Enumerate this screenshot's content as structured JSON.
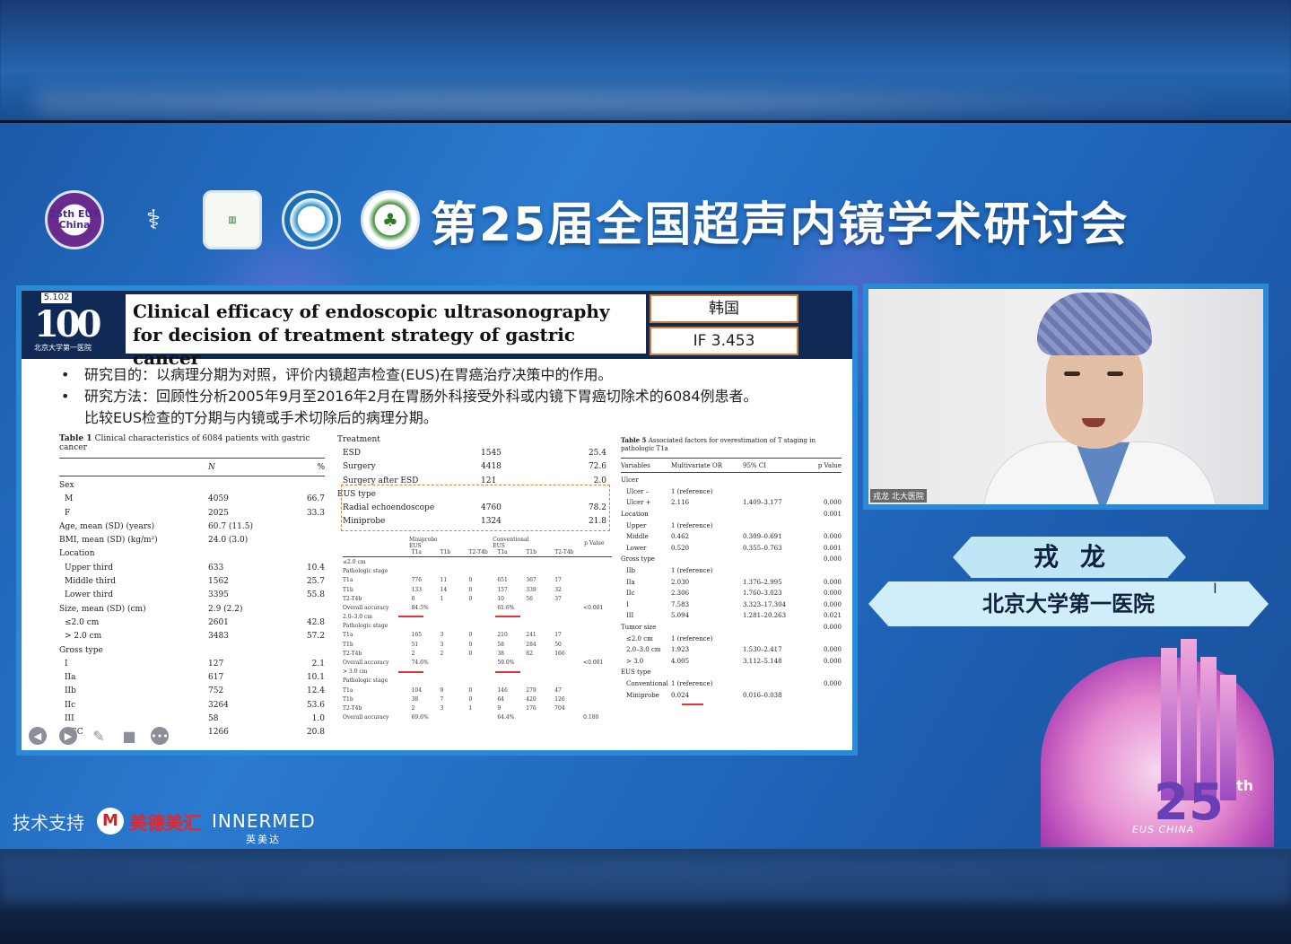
{
  "conference": {
    "title": "第25届全国超声内镜学术研讨会",
    "logo1_text": "25th EUS China",
    "logo25_number": "25",
    "logo25_suffix": "th",
    "logo25_caption": "EUS CHINA"
  },
  "slide": {
    "corner_badge": "5.102",
    "brand_mark": "100",
    "brand_sub": "北京大学第一医院",
    "paper_title": "Clinical efficacy of endoscopic ultrasonography for decision of treatment strategy of gastric cancer",
    "country": "韩国",
    "impact_factor": "IF 3.453",
    "bullets": [
      "研究目的：以病理分期为对照，评价内镜超声检查(EUS)在胃癌治疗决策中的作用。",
      "研究方法：回顾性分析2005年9月至2016年2月在胃肠外科接受外科或内镜下胃癌切除术的6084例患者。"
    ],
    "bullet2_cont": "比较EUS检查的T分期与内镜或手术切除后的病理分期。",
    "table1": {
      "caption_bold": "Table 1",
      "caption_rest": "Clinical characteristics of 6084 patients with gastric cancer",
      "headers": [
        "",
        "N",
        "%"
      ],
      "rows": [
        {
          "label": "Sex",
          "n": "",
          "p": "",
          "indent": 0
        },
        {
          "label": "M",
          "n": "4059",
          "p": "66.7",
          "indent": 1
        },
        {
          "label": "F",
          "n": "2025",
          "p": "33.3",
          "indent": 1
        },
        {
          "label": "Age, mean (SD) (years)",
          "n": "60.7 (11.5)",
          "p": "",
          "indent": 0
        },
        {
          "label": "BMI, mean (SD) (kg/m²)",
          "n": "24.0 (3.0)",
          "p": "",
          "indent": 0
        },
        {
          "label": "Location",
          "n": "",
          "p": "",
          "indent": 0
        },
        {
          "label": "Upper third",
          "n": "633",
          "p": "10.4",
          "indent": 1
        },
        {
          "label": "Middle third",
          "n": "1562",
          "p": "25.7",
          "indent": 1
        },
        {
          "label": "Lower third",
          "n": "3395",
          "p": "55.8",
          "indent": 1
        },
        {
          "label": "Size, mean (SD) (cm)",
          "n": "2.9 (2.2)",
          "p": "",
          "indent": 0
        },
        {
          "label": "≤2.0 cm",
          "n": "2601",
          "p": "42.8",
          "indent": 1
        },
        {
          "label": "> 2.0 cm",
          "n": "3483",
          "p": "57.2",
          "indent": 1
        },
        {
          "label": "Gross type",
          "n": "",
          "p": "",
          "indent": 0
        },
        {
          "label": "I",
          "n": "127",
          "p": "2.1",
          "indent": 1
        },
        {
          "label": "IIa",
          "n": "617",
          "p": "10.1",
          "indent": 1
        },
        {
          "label": "IIb",
          "n": "752",
          "p": "12.4",
          "indent": 1
        },
        {
          "label": "IIc",
          "n": "3264",
          "p": "53.6",
          "indent": 1
        },
        {
          "label": "III",
          "n": "58",
          "p": "1.0",
          "indent": 1
        },
        {
          "label": "AGC",
          "n": "1266",
          "p": "20.8",
          "indent": 1
        }
      ]
    },
    "table1_cont": {
      "rows": [
        {
          "label": "Treatment",
          "n": "",
          "p": "",
          "indent": 0
        },
        {
          "label": "ESD",
          "n": "1545",
          "p": "25.4",
          "indent": 1
        },
        {
          "label": "Surgery",
          "n": "4418",
          "p": "72.6",
          "indent": 1
        },
        {
          "label": "Surgery after ESD",
          "n": "121",
          "p": "2.0",
          "indent": 1
        },
        {
          "label": "EUS type",
          "n": "",
          "p": "",
          "indent": 0
        },
        {
          "label": "Radial echoendoscope",
          "n": "4760",
          "p": "78.2",
          "indent": 1
        },
        {
          "label": "Miniprobe",
          "n": "1324",
          "p": "21.8",
          "indent": 1
        }
      ]
    },
    "table4": {
      "headers": [
        "",
        "Miniprobe EUS",
        "",
        "",
        "Conventional EUS",
        "",
        "",
        "p Value"
      ],
      "subheaders": [
        "",
        "T1a",
        "T1b",
        "T2-T4b",
        "T1a",
        "T1b",
        "T2-T4b",
        ""
      ],
      "rows": [
        [
          "≤2.0 cm",
          "",
          "",
          "",
          "",
          "",
          "",
          ""
        ],
        [
          "Pathologic stage",
          "",
          "",
          "",
          "",
          "",
          "",
          ""
        ],
        [
          "T1a",
          "776",
          "11",
          "0",
          "651",
          "367",
          "17",
          ""
        ],
        [
          "T1b",
          "133",
          "14",
          "0",
          "157",
          "339",
          "32",
          ""
        ],
        [
          "T2-T4b",
          "0",
          "1",
          "0",
          "10",
          "56",
          "37",
          ""
        ],
        [
          "Overall accuracy",
          "84.5%",
          "",
          "",
          "61.6%",
          "",
          "",
          "<0.001"
        ],
        [
          "2.0–3.0 cm",
          "",
          "",
          "",
          "",
          "",
          "",
          ""
        ],
        [
          "Pathologic stage",
          "",
          "",
          "",
          "",
          "",
          "",
          ""
        ],
        [
          "T1a",
          "165",
          "3",
          "0",
          "210",
          "241",
          "17",
          ""
        ],
        [
          "T1b",
          "51",
          "3",
          "0",
          "58",
          "284",
          "50",
          ""
        ],
        [
          "T2-T4b",
          "2",
          "2",
          "0",
          "38",
          "82",
          "166",
          ""
        ],
        [
          "Overall accuracy",
          "74.6%",
          "",
          "",
          "59.0%",
          "",
          "",
          "<0.001"
        ],
        [
          "> 3.0 cm",
          "",
          "",
          "",
          "",
          "",
          "",
          ""
        ],
        [
          "Pathologic stage",
          "",
          "",
          "",
          "",
          "",
          "",
          ""
        ],
        [
          "T1a",
          "104",
          "9",
          "0",
          "146",
          "279",
          "47",
          ""
        ],
        [
          "T1b",
          "38",
          "7",
          "0",
          "64",
          "420",
          "126",
          ""
        ],
        [
          "T2-T4b",
          "2",
          "3",
          "1",
          "9",
          "176",
          "704",
          ""
        ],
        [
          "Overall accuracy",
          "69.6%",
          "",
          "",
          "64.4%",
          "",
          "",
          "0.180"
        ]
      ]
    },
    "table5": {
      "caption_bold": "Table 5",
      "caption_rest": "Associated factors for overestimation of T staging in pathologic T1a",
      "headers": [
        "Variables",
        "Multivariate OR",
        "95% CI",
        "p Value"
      ],
      "rows": [
        {
          "label": "Ulcer",
          "or": "",
          "ci": "",
          "p": "",
          "indent": 0
        },
        {
          "label": "Ulcer –",
          "or": "1 (reference)",
          "ci": "",
          "p": "",
          "indent": 1
        },
        {
          "label": "Ulcer +",
          "or": "2.116",
          "ci": "1.409–3.177",
          "p": "0.000",
          "indent": 1
        },
        {
          "label": "Location",
          "or": "",
          "ci": "",
          "p": "0.001",
          "indent": 0
        },
        {
          "label": "Upper",
          "or": "1 (reference)",
          "ci": "",
          "p": "",
          "indent": 1
        },
        {
          "label": "Middle",
          "or": "0.462",
          "ci": "0.309–0.691",
          "p": "0.000",
          "indent": 1
        },
        {
          "label": "Lower",
          "or": "0.520",
          "ci": "0.355–0.763",
          "p": "0.001",
          "indent": 1
        },
        {
          "label": "Gross type",
          "or": "",
          "ci": "",
          "p": "0.000",
          "indent": 0
        },
        {
          "label": "IIb",
          "or": "1 (reference)",
          "ci": "",
          "p": "",
          "indent": 1
        },
        {
          "label": "IIa",
          "or": "2.030",
          "ci": "1.376–2.995",
          "p": "0.000",
          "indent": 1
        },
        {
          "label": "IIc",
          "or": "2.306",
          "ci": "1.760–3.023",
          "p": "0.000",
          "indent": 1
        },
        {
          "label": "I",
          "or": "7.583",
          "ci": "3.323–17.304",
          "p": "0.000",
          "indent": 1
        },
        {
          "label": "III",
          "or": "5.094",
          "ci": "1.281–20.263",
          "p": "0.021",
          "indent": 1
        },
        {
          "label": "Tumor size",
          "or": "",
          "ci": "",
          "p": "0.000",
          "indent": 0
        },
        {
          "label": "≤2.0 cm",
          "or": "1 (reference)",
          "ci": "",
          "p": "",
          "indent": 1
        },
        {
          "label": "2.0–3.0 cm",
          "or": "1.923",
          "ci": "1.530–2.417",
          "p": "0.000",
          "indent": 1
        },
        {
          "label": "> 3.0",
          "or": "4.005",
          "ci": "3.112–5.148",
          "p": "0.000",
          "indent": 1
        },
        {
          "label": "EUS type",
          "or": "",
          "ci": "",
          "p": "",
          "indent": 0
        },
        {
          "label": "Conventional",
          "or": "1 (reference)",
          "ci": "",
          "p": "0.000",
          "indent": 1
        },
        {
          "label": "Miniprobe",
          "or": "0.024",
          "ci": "0.016–0.038",
          "p": "",
          "indent": 1
        }
      ]
    },
    "toolbar": [
      "back-icon",
      "forward-icon",
      "pen-icon",
      "camera-icon",
      "more-icon"
    ]
  },
  "speaker": {
    "video_label": "戎龙 北大医院",
    "name": "戎龙",
    "hospital": "北京大学第一医院"
  },
  "sponsor": {
    "label": "技术支持",
    "brand1_icon": "M",
    "brand1": "美德美汇",
    "brand2": "INNERMED",
    "brand2_cn": "英美达"
  },
  "colors": {
    "accent_blue": "#2b8ad6",
    "slide_header": "#102a55",
    "highlight_orange": "#d9833a",
    "underline_red": "#e0333a"
  }
}
